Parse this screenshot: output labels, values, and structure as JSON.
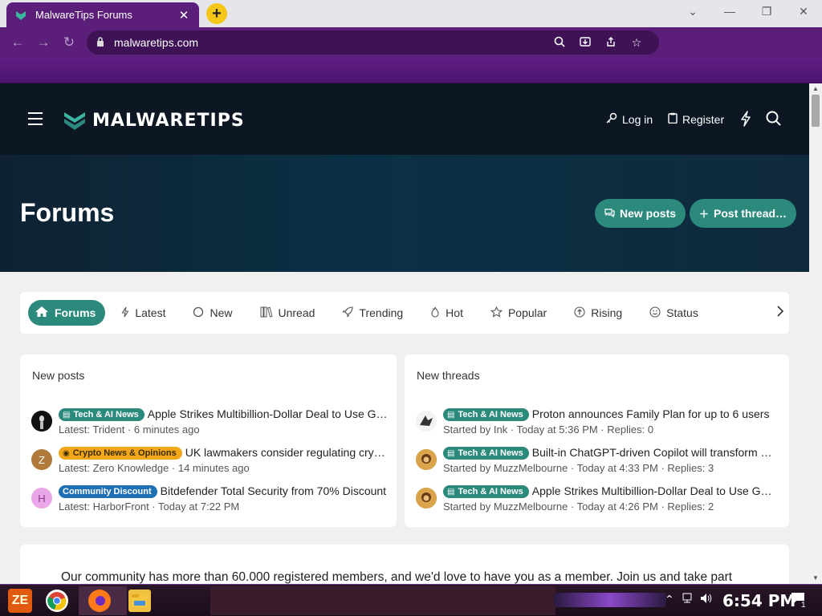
{
  "browser": {
    "tab_title": "MalwareTips Forums",
    "tab_close": "✕",
    "newtab": "+",
    "window_controls": [
      "⌄",
      "—",
      "❐",
      "✕"
    ],
    "url": "malwaretips.com"
  },
  "site": {
    "logo_text": "MALWARETIPS",
    "login": "Log in",
    "register": "Register"
  },
  "hero": {
    "title": "Forums",
    "new_posts": "New posts",
    "post_thread": "Post thread…"
  },
  "nav_tabs": [
    {
      "label": "Forums",
      "icon": "home-icon"
    },
    {
      "label": "Latest",
      "icon": "bolt-icon"
    },
    {
      "label": "New",
      "icon": "circle-icon"
    },
    {
      "label": "Unread",
      "icon": "books-icon"
    },
    {
      "label": "Trending",
      "icon": "rocket-icon"
    },
    {
      "label": "Hot",
      "icon": "fire-icon"
    },
    {
      "label": "Popular",
      "icon": "star-icon"
    },
    {
      "label": "Rising",
      "icon": "arrow-up-circle-icon"
    },
    {
      "label": "Status",
      "icon": "smile-icon"
    }
  ],
  "new_posts_panel": {
    "title": "New posts",
    "items": [
      {
        "badge": "Tech & AI News",
        "title": "Apple Strikes Multibillion-Dollar Deal to Use Google Gemini for Siri",
        "meta": "Latest: Trident · 6 minutes ago",
        "avatar_letter": ""
      },
      {
        "badge": "Crypto News & Opinions",
        "title": "UK lawmakers consider regulating crypto",
        "meta": "Latest: Zero Knowledge · 14 minutes ago",
        "avatar_letter": "Z"
      },
      {
        "badge": "Community Discount",
        "title": "Bitdefender Total Security from 70% Discount",
        "meta": "Latest: HarborFront · Today at 7:22 PM",
        "avatar_letter": "H"
      }
    ]
  },
  "new_threads_panel": {
    "title": "New threads",
    "items": [
      {
        "badge": "Tech & AI News",
        "title": "Proton announces Family Plan for up to 6 users",
        "meta": "Started by Ink · Today at 5:36 PM · Replies: 0"
      },
      {
        "badge": "Tech & AI News",
        "title": "Built-in ChatGPT-driven Copilot will transform Windows",
        "meta": "Started by MuzzMelbourne · Today at 4:33 PM · Replies: 3"
      },
      {
        "badge": "Tech & AI News",
        "title": "Apple Strikes Multibillion-Dollar Deal to Use Google Gemini",
        "meta": "Started by MuzzMelbourne · Today at 4:26 PM · Replies: 2"
      }
    ]
  },
  "join_text": "Our community has more than 60.000 registered members, and we'd love to have you as a member. Join us and take part",
  "taskbar": {
    "start_label": "ZE",
    "clock": "6:54 PM",
    "notifications": "1"
  },
  "colors": {
    "accent": "#2c8a7d",
    "browser_purple": "#5b1f7a",
    "header_bg": "#0d1724",
    "crypto_badge": "#f2a71b",
    "discount_badge": "#1f6fb5"
  }
}
